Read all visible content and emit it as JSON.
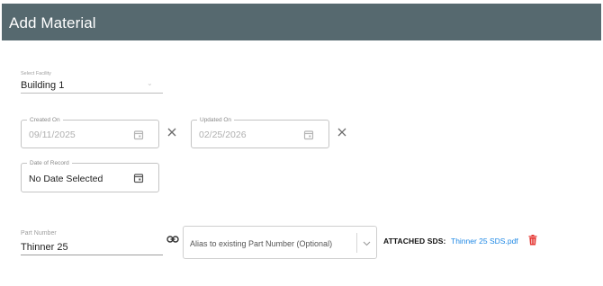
{
  "header": {
    "title": "Add Material",
    "background": "#56696f"
  },
  "facility": {
    "label": "Select Facility",
    "value": "Building 1"
  },
  "created_on": {
    "label": "Created On",
    "placeholder": "09/11/2025"
  },
  "updated_on": {
    "label": "Updated On",
    "placeholder": "02/25/2026"
  },
  "date_of_record": {
    "label": "Date of Record",
    "value": "No Date Selected"
  },
  "part_number": {
    "label": "Part Number",
    "value": "Thinner 25"
  },
  "alias": {
    "placeholder": "Alias to existing Part Number (Optional)"
  },
  "sds": {
    "label": "ATTACHED SDS:",
    "file_name": "Thinner 25 SDS.pdf",
    "link_color": "#1e88e5",
    "delete_color": "#e53935"
  },
  "icons": [
    "calendar-icon",
    "close-icon",
    "link-icon",
    "chevron-down-icon",
    "trash-icon"
  ]
}
